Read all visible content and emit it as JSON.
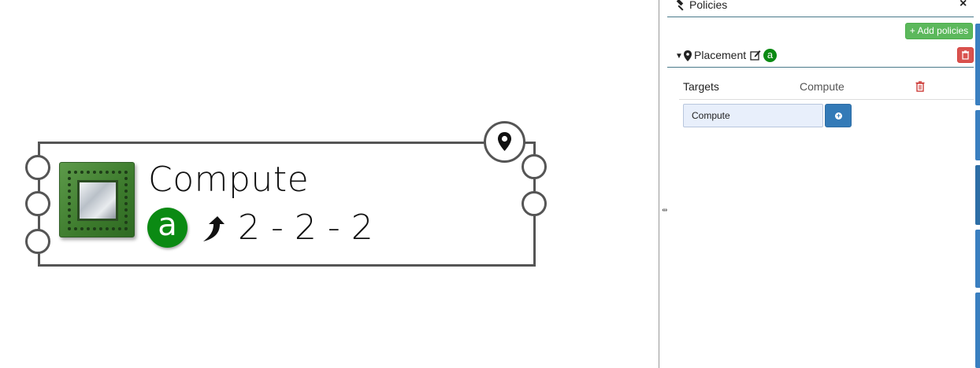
{
  "node": {
    "title": "Compute",
    "badge": "a",
    "scale_text": "2 - 2 - 2"
  },
  "panel": {
    "title": "Policies",
    "close": "×",
    "add_button": "+ Add policies",
    "policy": {
      "name": "Placement",
      "badge": "a"
    },
    "targets_label": "Targets",
    "targets_value": "Compute",
    "target_input_value": "Compute"
  },
  "colors": {
    "accent_green": "#5cb85c",
    "danger_red": "#d9534f",
    "primary_blue": "#337ab7",
    "badge_green": "#0b8a13"
  }
}
